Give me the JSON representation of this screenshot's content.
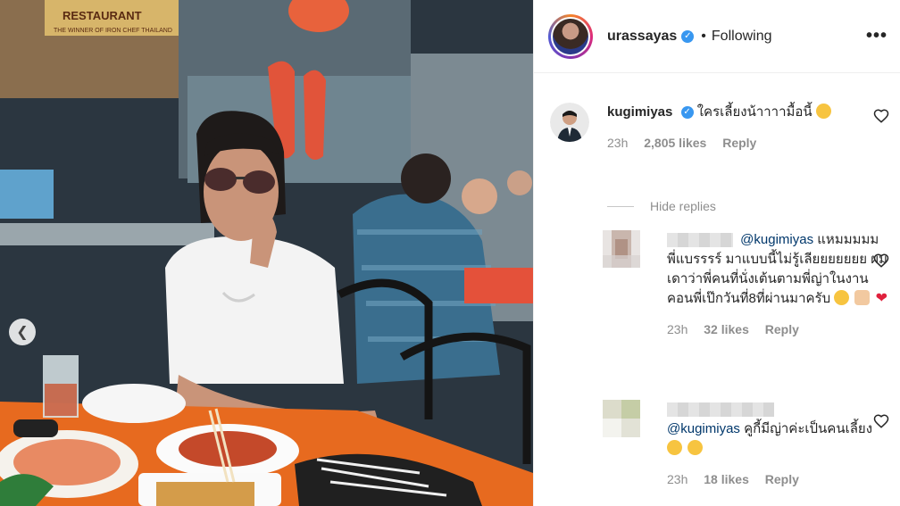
{
  "photo": {
    "sign_text": "THE WINNER OF IRON CHEF THAILAND",
    "sign_title": "RESTAURANT"
  },
  "header": {
    "username": "urassayas",
    "separator": "•",
    "follow_status": "Following",
    "more_label": "•••"
  },
  "comment": {
    "username": "kugimiyas",
    "text": "ใครเลี้ยงน้าาาามื้อนี้",
    "time": "23h",
    "likes": "2,805 likes",
    "reply_label": "Reply"
  },
  "hide_replies": "Hide replies",
  "replies": [
    {
      "mention": "@kugimiyas",
      "text": "แหมมมมม พี่แบรรรร์ มาแบบนี้ไม่รู้เลียยยยยยย ผมเดาว่าพี่คนที่นั่งเต้นตามพี่ญ่าในงานคอนพี่เป๊กวันที่8ที่ผ่านมาครับ",
      "time": "23h",
      "likes": "32 likes",
      "reply_label": "Reply"
    },
    {
      "mention": "@kugimiyas",
      "text": "คูกี้มีญ่าค่ะเป็นคนเลี้ยง",
      "time": "23h",
      "likes": "18 likes",
      "reply_label": "Reply"
    }
  ],
  "colors": {
    "verified": "#3897f0",
    "mention": "#00376b",
    "meta": "#8e8e8e"
  }
}
